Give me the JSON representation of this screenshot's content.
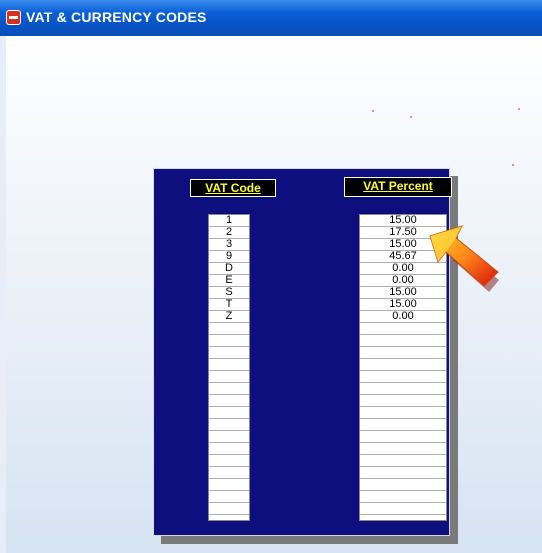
{
  "window": {
    "title": "VAT & CURRENCY CODES",
    "app_icon": "app-icon"
  },
  "table": {
    "code_header": "VAT Code",
    "percent_header": "VAT Percent",
    "rows": [
      {
        "code": "1",
        "percent": "15.00"
      },
      {
        "code": "2",
        "percent": "17.50"
      },
      {
        "code": "3",
        "percent": "15.00"
      },
      {
        "code": "9",
        "percent": "45.67"
      },
      {
        "code": "D",
        "percent": "0.00"
      },
      {
        "code": "E",
        "percent": "0.00"
      },
      {
        "code": "S",
        "percent": "15.00"
      },
      {
        "code": "T",
        "percent": "15.00"
      },
      {
        "code": "Z",
        "percent": "0.00"
      }
    ],
    "empty_rows": 16
  },
  "colors": {
    "panel": "#0d0f7e",
    "header_text": "#ffff33",
    "titlebar": "#0a5fd6"
  },
  "decorations": {
    "pointer": "arrow-pointer-icon"
  }
}
